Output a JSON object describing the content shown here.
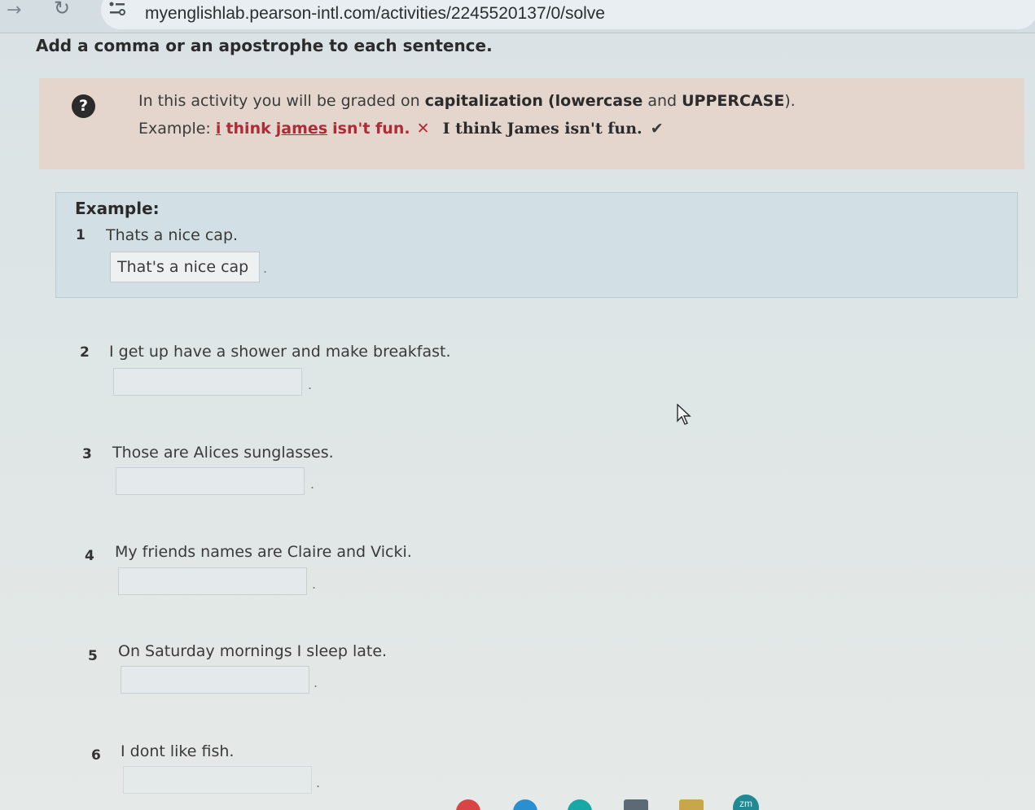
{
  "browser": {
    "url": "myenglishlab.pearson-intl.com/activities/2245520137/0/solve"
  },
  "page": {
    "title": "Add a comma or an apostrophe to each sentence."
  },
  "info": {
    "line1_prefix": "In this activity you will be graded on",
    "line1_term": "capitalization",
    "line1_paren_open": "(",
    "line1_lowercase": "lowercase",
    "line1_and": "and",
    "line1_uppercase": "UPPERCASE",
    "line1_paren_close": ").",
    "example_label": "Example:",
    "wrong_i": "i",
    "wrong_think": "think",
    "wrong_james": "james",
    "wrong_rest": "isn't fun.",
    "x_mark": "✕",
    "correct": "I think James isn't fun.",
    "check_mark": "✔"
  },
  "example": {
    "label": "Example:",
    "number": "1",
    "sentence": "Thats a nice cap.",
    "answer": "That's a nice cap",
    "period": "."
  },
  "questions": [
    {
      "number": "2",
      "sentence": "I get up have a shower and make breakfast.",
      "answer": "",
      "period": "."
    },
    {
      "number": "3",
      "sentence": "Those are Alices sunglasses.",
      "answer": "",
      "period": "."
    },
    {
      "number": "4",
      "sentence": "My friends names are Claire and Vicki.",
      "answer": "",
      "period": "."
    },
    {
      "number": "5",
      "sentence": "On Saturday mornings I sleep late.",
      "answer": "",
      "period": "."
    },
    {
      "number": "6",
      "sentence": "I dont like fish.",
      "answer": "",
      "period": "."
    }
  ],
  "taskbar": {
    "zoom_label": "zm"
  },
  "colors": {
    "info_bg": "#e4d6cc",
    "example_bg": "#d2e0e5",
    "error_red": "#b02a37",
    "zoom_teal": "#1f8a93"
  },
  "icons": [
    "forward-arrow-icon",
    "reload-icon",
    "site-info-icon",
    "help-icon",
    "cross-icon",
    "check-icon",
    "mouse-cursor-icon",
    "zoom-app-icon"
  ]
}
